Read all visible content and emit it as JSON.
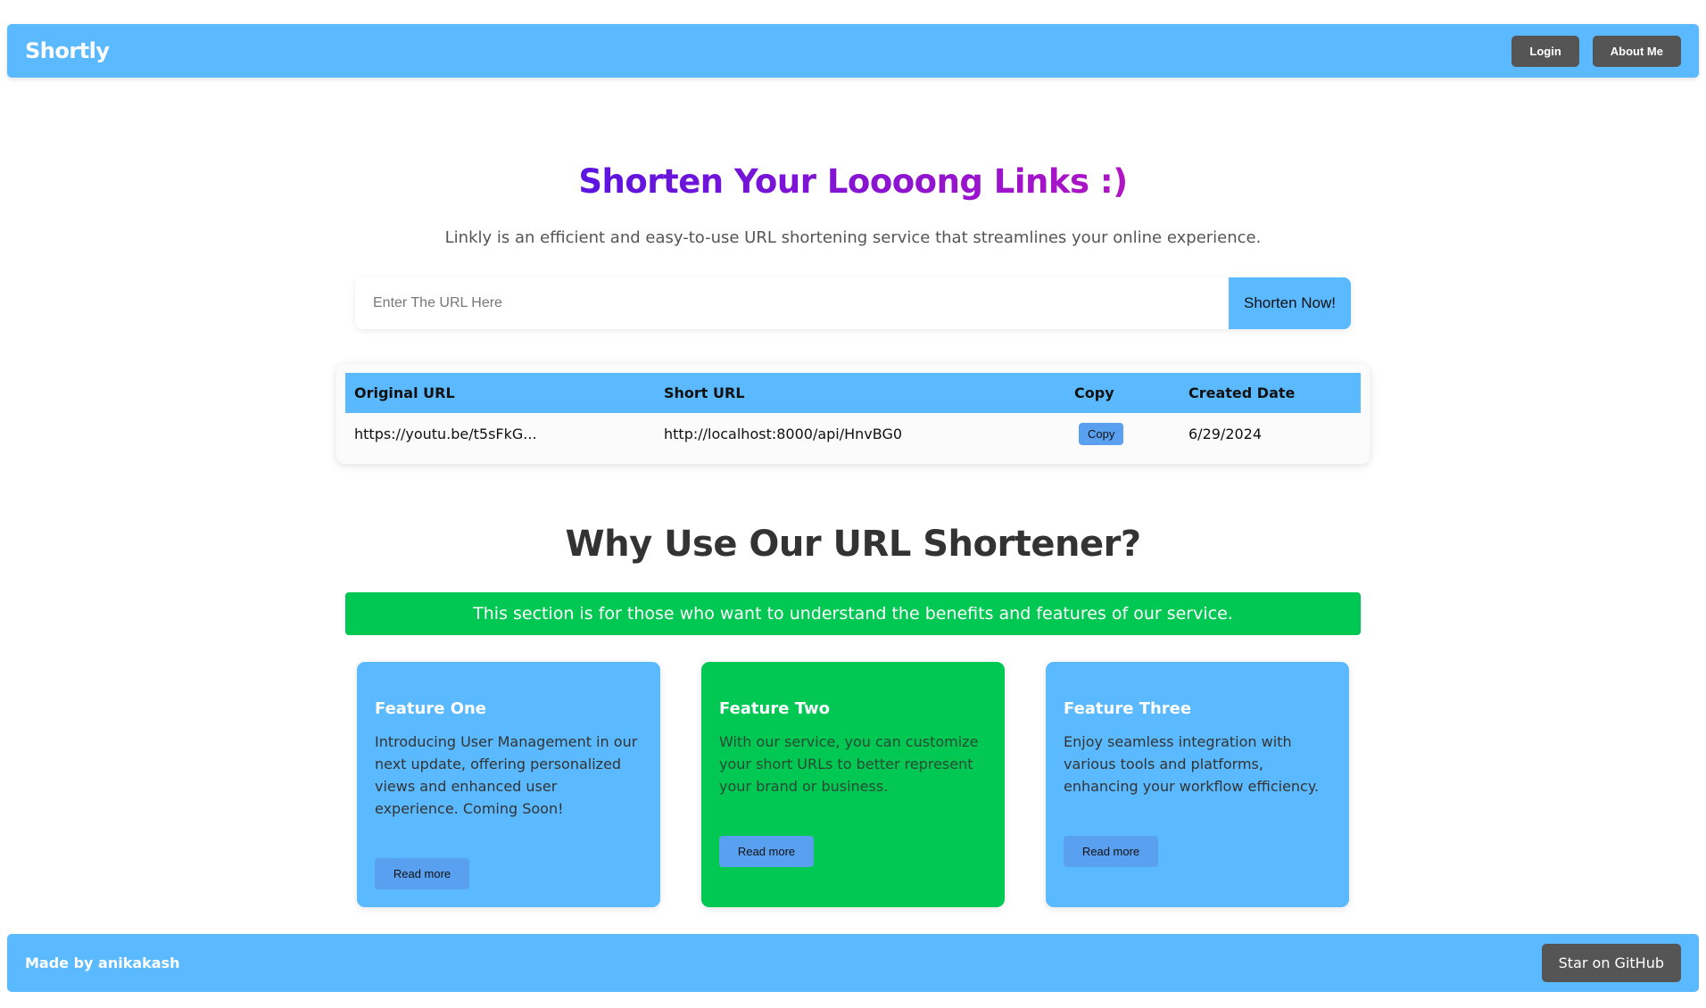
{
  "navbar": {
    "brand": "Shortly",
    "buttons": [
      {
        "label": "Login"
      },
      {
        "label": "About Me"
      }
    ]
  },
  "hero": {
    "title": "Shorten Your Loooong Links :)",
    "subtitle": "Linkly is an efficient and easy-to-use URL shortening service that streamlines your online experience.",
    "input": {
      "placeholder": "Enter The URL Here",
      "value": ""
    },
    "submit_label": "Shorten Now!"
  },
  "links_table": {
    "headers": [
      "Original URL",
      "Short URL",
      "Copy",
      "Created Date"
    ],
    "rows": [
      {
        "original_url": "https://youtu.be/t5sFkG...",
        "short_url": "http://localhost:8000/api/HnvBG0",
        "copy_label": "Copy",
        "created_date": "6/29/2024"
      }
    ]
  },
  "why": {
    "title": "Why Use Our URL Shortener?",
    "banner": "This section is for those who want to understand the benefits and features of our service."
  },
  "features": [
    {
      "title": "Feature One",
      "text": "Introducing User Management in our next update, offering personalized views and enhanced user experience. Coming Soon!",
      "button": "Read more",
      "color": "#5bbaff"
    },
    {
      "title": "Feature Two",
      "text": "With our service, you can customize your short URLs to better represent your brand or business.",
      "button": "Read more",
      "color": "#00c853"
    },
    {
      "title": "Feature Three",
      "text": "Enjoy seamless integration with various tools and platforms, enhancing your workflow efficiency.",
      "button": "Read more",
      "color": "#5bbaff"
    }
  ],
  "footer": {
    "credit": "Made by anikakash",
    "github_label": "Star on GitHub"
  },
  "colors": {
    "primary": "#5bbaff",
    "accent_green": "#00c853",
    "dark_button": "#555555",
    "button_blue": "#5aa0f0",
    "title_gradient_start": "#5b14e0",
    "title_gradient_end": "#b114c4"
  }
}
